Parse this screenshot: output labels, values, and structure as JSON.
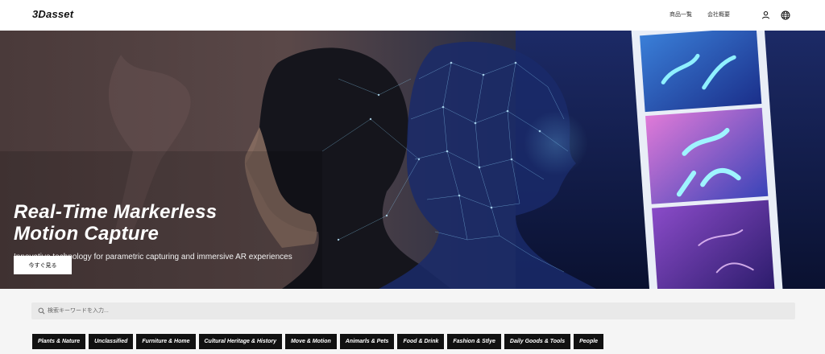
{
  "header": {
    "logo": "3Dasset",
    "nav": [
      {
        "label": "商品一覧"
      },
      {
        "label": "会社概要"
      }
    ],
    "icons": [
      "user-icon",
      "globe-icon"
    ]
  },
  "hero": {
    "title_line1": "Real-Time Markerless",
    "title_line2": "Motion Capture",
    "subtitle": "Innovative technology for parametric capturing and immersive AR experiences",
    "cta_label": "今すぐ見る"
  },
  "search": {
    "placeholder": "検索キーワードを入力..."
  },
  "categories": [
    "Plants & Nature",
    "Unclassified",
    "Furniture & Home",
    "Cultural Heritage & History",
    "Move & Motion",
    "Animarls & Pets",
    "Food & Drink",
    "Fashion & Stlye",
    "Daily Goods & Tools",
    "People"
  ],
  "colors": {
    "header_bg": "#ffffff",
    "page_bg": "#f5f5f5",
    "hero_bg": "#0d1730",
    "category_bg": "#111111",
    "accent_cyan": "#5fd4ff"
  }
}
